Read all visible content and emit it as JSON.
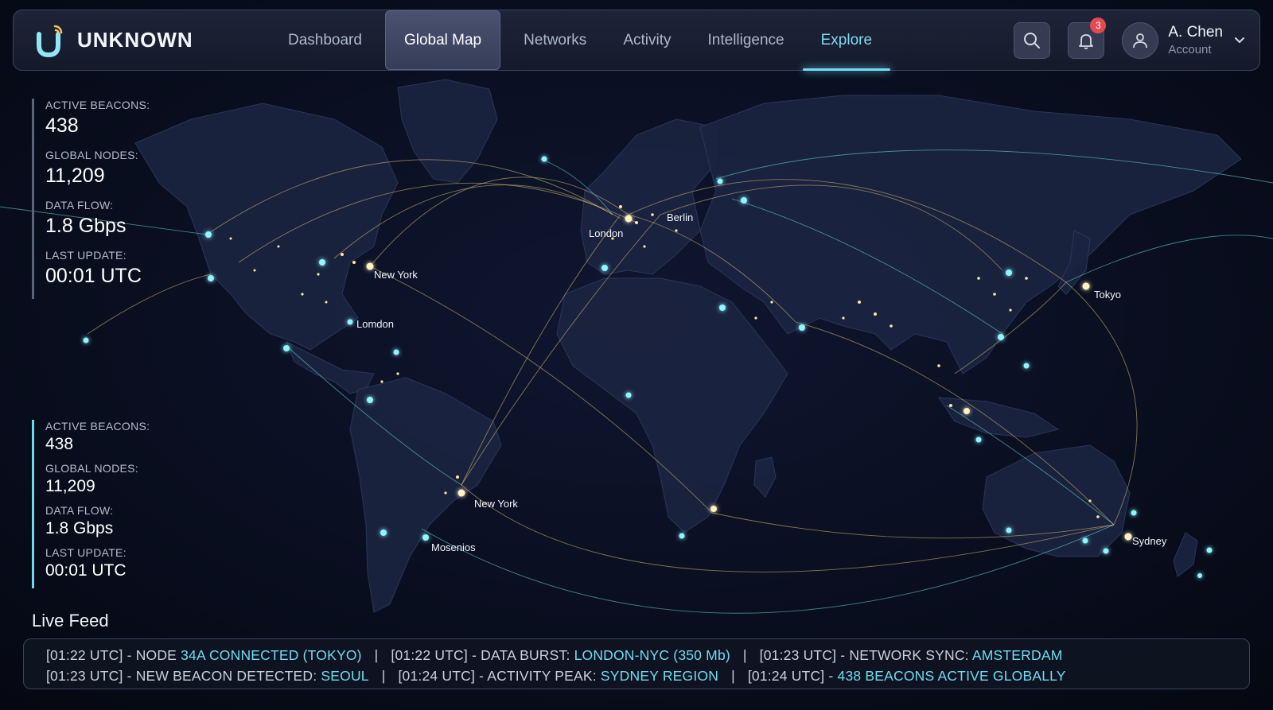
{
  "brand": {
    "name": "UNKNOWN",
    "logo_icon": "u-signal-logo-icon"
  },
  "nav": {
    "items": [
      {
        "label": "Dashboard"
      },
      {
        "label": "Global Map"
      },
      {
        "label": "Networks"
      },
      {
        "label": "Activity"
      },
      {
        "label": "Intelligence"
      },
      {
        "label": "Explore"
      }
    ],
    "selected": "Global Map",
    "highlighted": "Explore"
  },
  "toolbar": {
    "search_icon": "search-icon",
    "bell_icon": "bell-icon",
    "notification_count": "3",
    "user": {
      "name": "A. Chen",
      "subtitle": "Account"
    }
  },
  "stats_primary": {
    "active_beacons_label": "ACTIVE BEACONS:",
    "active_beacons_value": "438",
    "global_nodes_label": "GLOBAL NODES:",
    "global_nodes_value": "11,209",
    "data_flow_label": "DATA FLOW:",
    "data_flow_value": "1.8 Gbps",
    "last_update_label": "LAST UPDATE:",
    "last_update_value": "00:01 UTC"
  },
  "stats_secondary": {
    "active_beacons_label": "ACTIVE BEACONS:",
    "active_beacons_value": "438",
    "global_nodes_label": "GLOBAL NODES:",
    "global_nodes_value": "11,209",
    "data_flow_label": "DATA FLOW:",
    "data_flow_value": "1.8 Gbps",
    "last_update_label": "LAST UPDATE:",
    "last_update_value": "00:01 UTC"
  },
  "map_labels": {
    "london_eu": "London",
    "berlin": "Berlin",
    "new_york_na": "New York",
    "london_na": "Lomdon",
    "tokyo": "Tokyo",
    "new_york_sa": "New York",
    "mosenios": "Mosenios",
    "sydney": "Sydney"
  },
  "feed": {
    "title": "Live Feed",
    "line1": [
      {
        "prefix": "[01:22 UTC] - NODE ",
        "highlight": "34A CONNECTED (TOKYO)"
      },
      {
        "prefix": "[01:22 UTC] - DATA BURST: ",
        "highlight": "LONDON-NYC (350 Mb)"
      },
      {
        "prefix": "[01:23 UTC] - NETWORK SYNC: ",
        "highlight": "AMSTERDAM"
      }
    ],
    "line2": [
      {
        "prefix": "[01:23 UTC] - NEW BEACON DETECTED: ",
        "highlight": "SEOUL"
      },
      {
        "prefix": "[01:24 UTC] - ACTIVITY PEAK: ",
        "highlight": "SYDNEY REGION"
      },
      {
        "prefix": "[01:24 UTC] - ",
        "highlight": "438 BEACONS ACTIVE GLOBALLY"
      }
    ],
    "separator": "|"
  },
  "colors": {
    "accent_cyan": "#6fdcf0",
    "arc_gold": "#e8c878",
    "background": "#070b18",
    "badge_red": "#e34a52"
  }
}
